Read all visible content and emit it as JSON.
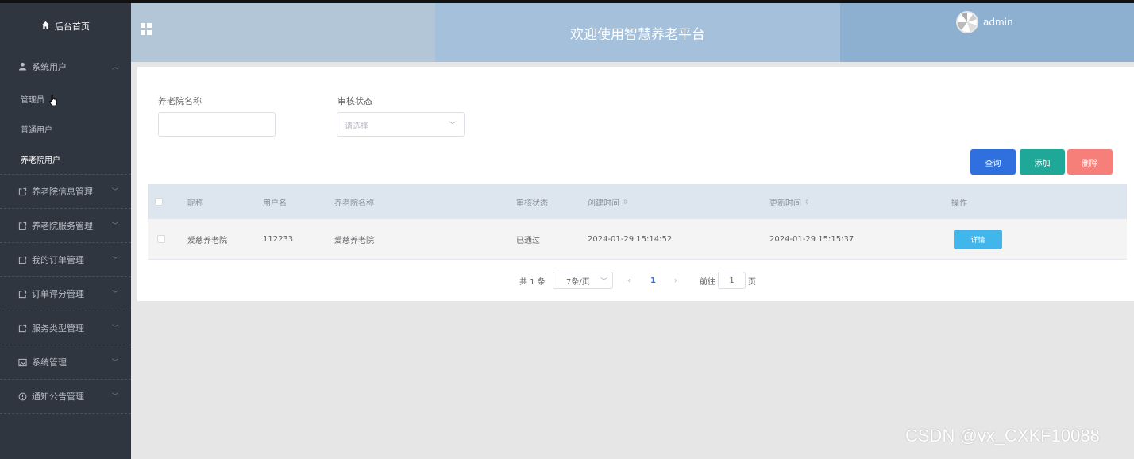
{
  "sidebar": {
    "home": "后台首页",
    "groups": [
      {
        "label": "系统用户",
        "icon": "user-icon",
        "expanded": true,
        "children": [
          {
            "label": "管理员"
          },
          {
            "label": "普通用户"
          },
          {
            "label": "养老院用户",
            "active": true
          }
        ]
      },
      {
        "label": "养老院信息管理",
        "icon": "share-box-icon"
      },
      {
        "label": "养老院服务管理",
        "icon": "share-box-icon"
      },
      {
        "label": "我的订单管理",
        "icon": "share-box-icon"
      },
      {
        "label": "订单评分管理",
        "icon": "share-box-icon"
      },
      {
        "label": "服务类型管理",
        "icon": "share-box-icon"
      },
      {
        "label": "系统管理",
        "icon": "picture-icon"
      },
      {
        "label": "通知公告管理",
        "icon": "info-circle-icon"
      }
    ]
  },
  "header": {
    "title": "欢迎使用智慧养老平台",
    "username": "admin"
  },
  "filters": {
    "name_label": "养老院名称",
    "name_value": "",
    "status_label": "审核状态",
    "status_placeholder": "请选择"
  },
  "actions": {
    "query": "查询",
    "add": "添加",
    "delete": "删除"
  },
  "table": {
    "columns": [
      "昵称",
      "用户名",
      "养老院名称",
      "审核状态",
      "创建时间",
      "更新时间",
      "操作"
    ],
    "rows": [
      {
        "nickname": "爱慈养老院",
        "username": "112233",
        "home_name": "爱慈养老院",
        "status": "已通过",
        "created": "2024-01-29 15:14:52",
        "updated": "2024-01-29 15:15:37",
        "action": "详情"
      }
    ]
  },
  "pagination": {
    "total": "共 1 条",
    "page_size": "7条/页",
    "current_page": "1",
    "goto_label": "前往",
    "goto_value": "1",
    "page_suffix": "页"
  },
  "watermark": "CSDN @vx_CXKF10088",
  "colors": {
    "sidebar_bg": "#303640",
    "query_btn": "#2f6fde",
    "add_btn": "#1fa898",
    "delete_btn": "#f67f7a",
    "detail_btn": "#41b6ea"
  }
}
